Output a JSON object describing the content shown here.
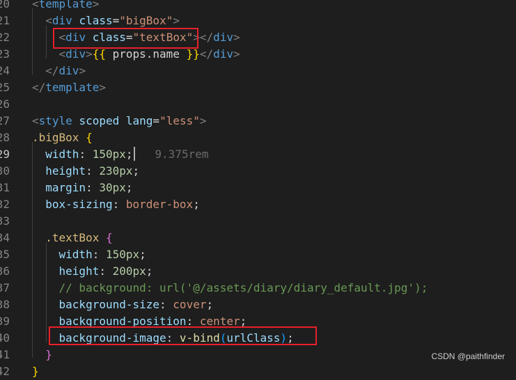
{
  "editor": {
    "lines": [
      {
        "n": "20",
        "tokens": [
          [
            "punc",
            "<"
          ],
          [
            "tag",
            "template"
          ],
          [
            "punc",
            ">"
          ]
        ]
      },
      {
        "n": "21",
        "tokens": [
          [
            "plain",
            "  "
          ],
          [
            "punc",
            "<"
          ],
          [
            "tag",
            "div"
          ],
          [
            "plain",
            " "
          ],
          [
            "attr",
            "class"
          ],
          [
            "plain",
            "="
          ],
          [
            "str",
            "\"bigBox\""
          ],
          [
            "punc",
            ">"
          ]
        ]
      },
      {
        "n": "22",
        "tokens": [
          [
            "plain",
            "    "
          ],
          [
            "punc",
            "<"
          ],
          [
            "tag",
            "div"
          ],
          [
            "plain",
            " "
          ],
          [
            "attr",
            "class"
          ],
          [
            "plain",
            "="
          ],
          [
            "str",
            "\"textBox\""
          ],
          [
            "punc",
            "></"
          ],
          [
            "tag",
            "div"
          ],
          [
            "punc",
            ">"
          ]
        ]
      },
      {
        "n": "23",
        "tokens": [
          [
            "plain",
            "    "
          ],
          [
            "punc",
            "<"
          ],
          [
            "tag",
            "div"
          ],
          [
            "punc",
            ">"
          ],
          [
            "brace",
            "{{"
          ],
          [
            "plain",
            " props.name "
          ],
          [
            "brace",
            "}}"
          ],
          [
            "punc",
            "</"
          ],
          [
            "tag",
            "div"
          ],
          [
            "punc",
            ">"
          ]
        ]
      },
      {
        "n": "24",
        "tokens": [
          [
            "plain",
            "  "
          ],
          [
            "punc",
            "</"
          ],
          [
            "tag",
            "div"
          ],
          [
            "punc",
            ">"
          ]
        ]
      },
      {
        "n": "25",
        "tokens": [
          [
            "punc",
            "</"
          ],
          [
            "tag",
            "template"
          ],
          [
            "punc",
            ">"
          ]
        ]
      },
      {
        "n": "26",
        "tokens": []
      },
      {
        "n": "27",
        "tokens": [
          [
            "punc",
            "<"
          ],
          [
            "tag",
            "style"
          ],
          [
            "plain",
            " "
          ],
          [
            "attr",
            "scoped"
          ],
          [
            "plain",
            " "
          ],
          [
            "attr",
            "lang"
          ],
          [
            "plain",
            "="
          ],
          [
            "str",
            "\"less\""
          ],
          [
            "punc",
            ">"
          ]
        ]
      },
      {
        "n": "28",
        "tokens": [
          [
            "sel",
            ".bigBox"
          ],
          [
            "plain",
            " "
          ],
          [
            "brace",
            "{"
          ]
        ]
      },
      {
        "n": "29",
        "active": true,
        "cursor": true,
        "tokens": [
          [
            "plain",
            "  "
          ],
          [
            "prop",
            "width"
          ],
          [
            "plain",
            ": "
          ],
          [
            "num",
            "150px"
          ],
          [
            "plain",
            ";"
          ]
        ],
        "hint": "9.375rem"
      },
      {
        "n": "30",
        "tokens": [
          [
            "plain",
            "  "
          ],
          [
            "prop",
            "height"
          ],
          [
            "plain",
            ": "
          ],
          [
            "num",
            "230px"
          ],
          [
            "plain",
            ";"
          ]
        ]
      },
      {
        "n": "31",
        "tokens": [
          [
            "plain",
            "  "
          ],
          [
            "prop",
            "margin"
          ],
          [
            "plain",
            ": "
          ],
          [
            "num",
            "30px"
          ],
          [
            "plain",
            ";"
          ]
        ]
      },
      {
        "n": "32",
        "tokens": [
          [
            "plain",
            "  "
          ],
          [
            "prop",
            "box-sizing"
          ],
          [
            "plain",
            ": "
          ],
          [
            "val",
            "border-box"
          ],
          [
            "plain",
            ";"
          ]
        ]
      },
      {
        "n": "33",
        "tokens": []
      },
      {
        "n": "34",
        "tokens": [
          [
            "plain",
            "  "
          ],
          [
            "sel",
            ".textBox"
          ],
          [
            "plain",
            " "
          ],
          [
            "brace2",
            "{"
          ]
        ]
      },
      {
        "n": "35",
        "tokens": [
          [
            "plain",
            "    "
          ],
          [
            "prop",
            "width"
          ],
          [
            "plain",
            ": "
          ],
          [
            "num",
            "150px"
          ],
          [
            "plain",
            ";"
          ]
        ]
      },
      {
        "n": "36",
        "tokens": [
          [
            "plain",
            "    "
          ],
          [
            "prop",
            "height"
          ],
          [
            "plain",
            ": "
          ],
          [
            "num",
            "200px"
          ],
          [
            "plain",
            ";"
          ]
        ]
      },
      {
        "n": "37",
        "tokens": [
          [
            "plain",
            "    "
          ],
          [
            "cmt",
            "// background: url('@/assets/diary/diary_default.jpg');"
          ]
        ]
      },
      {
        "n": "38",
        "tokens": [
          [
            "plain",
            "    "
          ],
          [
            "prop",
            "background-size"
          ],
          [
            "plain",
            ": "
          ],
          [
            "val",
            "cover"
          ],
          [
            "plain",
            ";"
          ]
        ]
      },
      {
        "n": "39",
        "tokens": [
          [
            "plain",
            "    "
          ],
          [
            "prop",
            "background-position"
          ],
          [
            "plain",
            ": "
          ],
          [
            "val",
            "center"
          ],
          [
            "plain",
            ";"
          ]
        ]
      },
      {
        "n": "40",
        "tokens": [
          [
            "plain",
            "    "
          ],
          [
            "prop",
            "background-image"
          ],
          [
            "plain",
            ": "
          ],
          [
            "fn",
            "v-bind"
          ],
          [
            "brace3",
            "("
          ],
          [
            "prop",
            "urlClass"
          ],
          [
            "brace3",
            ")"
          ],
          [
            "plain",
            ";"
          ]
        ]
      },
      {
        "n": "41",
        "tokens": [
          [
            "plain",
            "  "
          ],
          [
            "brace2",
            "}"
          ]
        ]
      },
      {
        "n": "42",
        "tokens": [
          [
            "brace",
            "}"
          ]
        ]
      }
    ]
  },
  "watermark": "CSDN @paithfinder"
}
